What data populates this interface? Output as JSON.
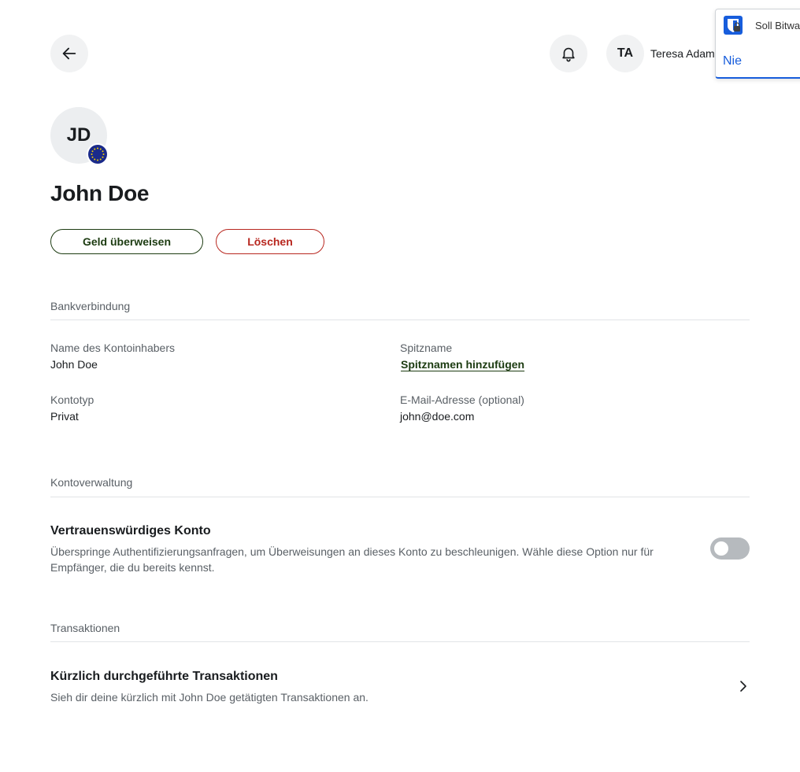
{
  "header": {
    "user_initials": "TA",
    "user_name": "Teresa Adam"
  },
  "bitwarden_prompt": {
    "title": "Soll Bitwa",
    "never_label": "Nie"
  },
  "profile": {
    "initials": "JD",
    "name": "John Doe",
    "transfer_label": "Geld überweisen",
    "delete_label": "Löschen"
  },
  "bank_details": {
    "section_title": "Bankverbindung",
    "holder_label": "Name des Kontoinhabers",
    "holder_value": "John Doe",
    "nickname_label": "Spitzname",
    "nickname_action": "Spitznamen hinzufügen",
    "account_type_label": "Kontotyp",
    "account_type_value": "Privat",
    "email_label": "E-Mail-Adresse (optional)",
    "email_value": "john@doe.com"
  },
  "account_management": {
    "section_title": "Kontoverwaltung",
    "trusted_title": "Vertrauenswürdiges Konto",
    "trusted_desc": "Überspringe Authentifizierungsanfragen, um Überweisungen an dieses Konto zu beschleunigen. Wähle diese Option nur für Empfänger, die du bereits kennst.",
    "trusted_enabled": false
  },
  "transactions": {
    "section_title": "Transaktionen",
    "recent_title": "Kürzlich durchgeführte Transaktionen",
    "recent_desc": "Sieh dir deine kürzlich mit John Doe getätigten Transaktionen an."
  },
  "icons": {
    "back": "arrow-left-icon",
    "notifications": "bell-icon",
    "flag": "eu-flag-icon",
    "chevron": "chevron-right-icon",
    "bitwarden": "bitwarden-logo-icon"
  },
  "colors": {
    "accent_green": "#1c3b11",
    "danger_red": "#b8271f",
    "bitwarden_blue": "#175ddc"
  }
}
